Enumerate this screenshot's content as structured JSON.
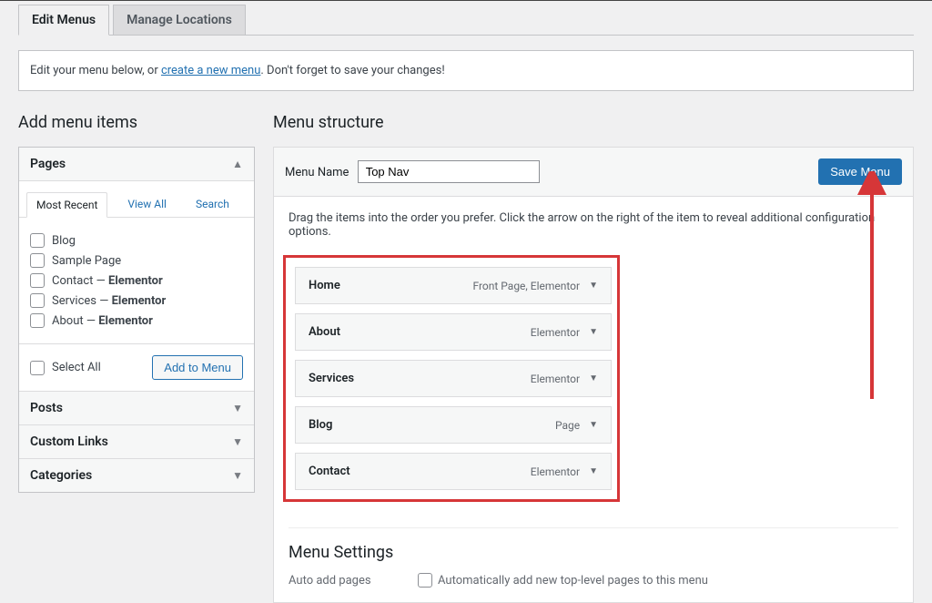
{
  "tabs": {
    "edit": "Edit Menus",
    "manage": "Manage Locations"
  },
  "notice": {
    "pre": "Edit your menu below, or ",
    "link": "create a new menu",
    "post": ". Don't forget to save your changes!"
  },
  "sidebar": {
    "title": "Add menu items",
    "panels": {
      "pages": "Pages",
      "posts": "Posts",
      "custom_links": "Custom Links",
      "categories": "Categories"
    },
    "inner_tabs": {
      "recent": "Most Recent",
      "view_all": "View All",
      "search": "Search"
    },
    "pages_list": [
      {
        "label": "Blog",
        "suffix": ""
      },
      {
        "label": "Sample Page",
        "suffix": ""
      },
      {
        "label": "Contact",
        "suffix": "Elementor"
      },
      {
        "label": "Services",
        "suffix": "Elementor"
      },
      {
        "label": "About",
        "suffix": "Elementor"
      }
    ],
    "select_all": "Select All",
    "add_to_menu": "Add to Menu"
  },
  "main": {
    "title": "Menu structure",
    "menu_name_label": "Menu Name",
    "menu_name_value": "Top Nav",
    "save_button": "Save Menu",
    "instruction": "Drag the items into the order you prefer. Click the arrow on the right of the item to reveal additional configuration options.",
    "items": [
      {
        "title": "Home",
        "meta": "Front Page, Elementor"
      },
      {
        "title": "About",
        "meta": "Elementor"
      },
      {
        "title": "Services",
        "meta": "Elementor"
      },
      {
        "title": "Blog",
        "meta": "Page"
      },
      {
        "title": "Contact",
        "meta": "Elementor"
      }
    ],
    "settings": {
      "heading": "Menu Settings",
      "auto_add_label": "Auto add pages",
      "auto_add_checkbox": "Automatically add new top-level pages to this menu"
    }
  },
  "colors": {
    "accent": "#2271b1",
    "danger": "#d63638"
  }
}
